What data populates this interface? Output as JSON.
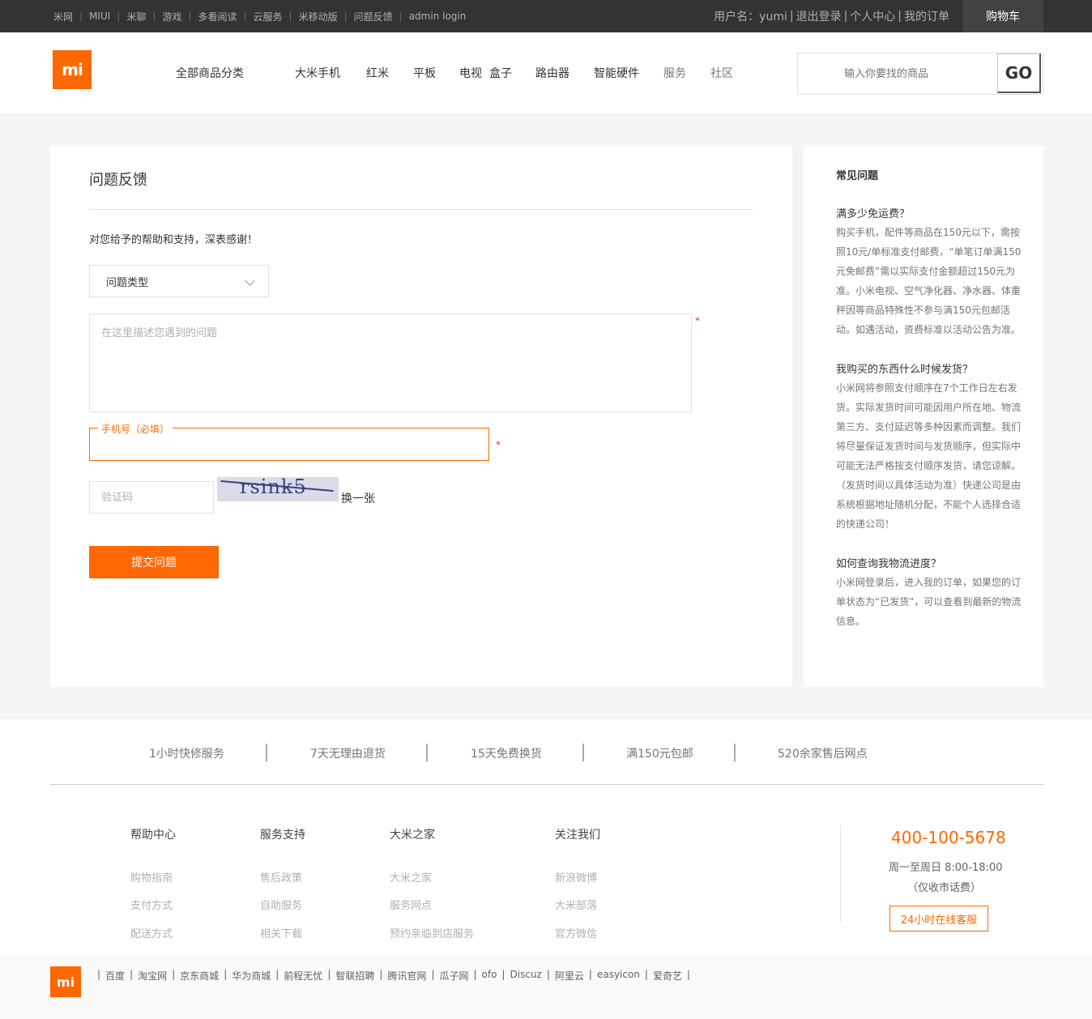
{
  "topbar": {
    "links": [
      "米网",
      "MIUI",
      "米聊",
      "游戏",
      "多看阅读",
      "云服务",
      "米移动版",
      "问题反馈",
      "admin login"
    ],
    "user_label": "用户名：yumi",
    "logout": "退出登录",
    "personal": "个人中心",
    "orders": "我的订单",
    "cart": "购物车"
  },
  "header": {
    "logo": "mi",
    "nav": [
      "全部商品分类",
      "大米手机",
      "红米",
      "平板",
      "电视",
      "盒子",
      "路由器",
      "智能硬件",
      "服务",
      "社区"
    ],
    "search_placeholder": "输入你要找的商品",
    "go": "GO"
  },
  "form": {
    "title": "问题反馈",
    "thanks": "对您给予的帮助和支持，深表感谢！",
    "type_select": "问题类型",
    "desc_placeholder": "在这里描述您遇到的问题",
    "required_mark": "*",
    "phone_label": "手机号（必填）",
    "captcha_placeholder": "验证码",
    "captcha_code": "rsink5",
    "refresh": "换一张",
    "submit": "提交问题"
  },
  "faq": {
    "title": "常见问题",
    "items": [
      {
        "q": "满多少免运费？",
        "a": "购买手机，配件等商品在150元以下，需按照10元/单标准支付邮费，“单笔订单满150元免邮费”需以实际支付金额超过150元为准。小米电视、空气净化器、净水器、体重秤因等商品特殊性不参与满150元包邮活动。如遇活动，资费标准以活动公告为准。"
      },
      {
        "q": "我购买的东西什么时候发货？",
        "a": "小米网将参照支付顺序在7个工作日左右发货。实际发货时间可能因用户所在地、物流第三方、支付延迟等多种因素而调整。我们将尽量保证发货时间与发货顺序，但实际中可能无法严格按支付顺序发货，请您谅解。（发货时间以具体活动为准）快递公司是由系统根据地址随机分配，不能个人选择合适的快递公司！"
      },
      {
        "q": "如何查询我物流进度？",
        "a": "小米网登录后，进入我的订单，如果您的订单状态为“已发货”，可以查看到最新的物流信息。"
      }
    ]
  },
  "footer": {
    "services": [
      "1小时快修服务",
      "7天无理由退货",
      "15天免费换货",
      "满150元包邮",
      "520余家售后网点"
    ],
    "columns": [
      {
        "title": "帮助中心",
        "links": [
          "购物指南",
          "支付方式",
          "配送方式"
        ]
      },
      {
        "title": "服务支持",
        "links": [
          "售后政策",
          "自助服务",
          "相关下载"
        ]
      },
      {
        "title": "大米之家",
        "links": [
          "大米之家",
          "服务网点",
          "预约亲临到店服务"
        ]
      },
      {
        "title": "关注我们",
        "links": [
          "新浪微博",
          "大米部落",
          "官方微信"
        ]
      }
    ],
    "hotline": "400-100-5678",
    "hours": "周一至周日 8:00-18:00",
    "fee": "（仅收市话费）",
    "chat": "24小时在线客服",
    "friend_links": [
      "百度",
      "淘宝网",
      "京东商城",
      "华为商城",
      "前程无忧",
      "智联招聘",
      "腾讯官网",
      "瓜子网",
      "ofo",
      "Discuz",
      "阿里云",
      "easyicon",
      "爱奇艺"
    ]
  }
}
